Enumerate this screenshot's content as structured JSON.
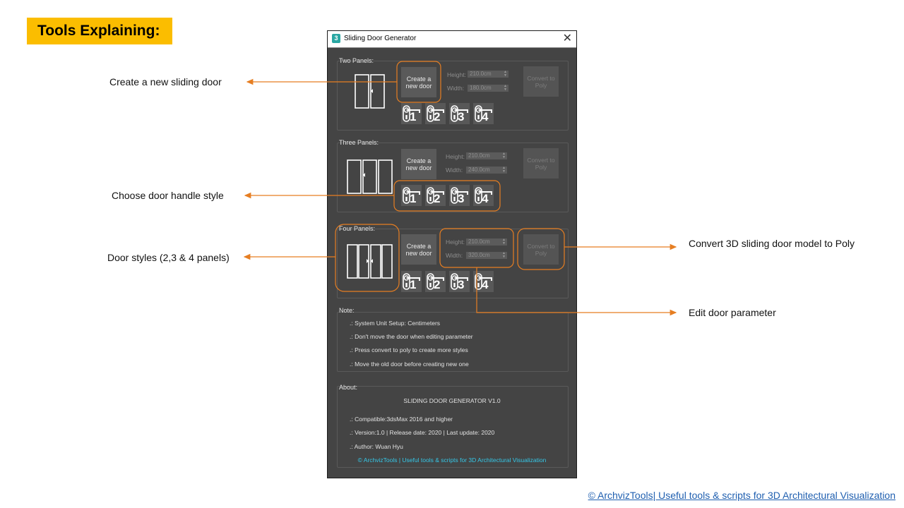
{
  "page": {
    "heading": "Tools Explaining:",
    "footer_link": "© ArchvizTools| Useful tools & scripts for 3D Architectural Visualization"
  },
  "annotations": {
    "create": "Create a new sliding door",
    "handle": "Choose door handle style",
    "styles": "Door styles (2,3 & 4 panels)",
    "convert": "Convert 3D sliding door model to Poly",
    "edit": "Edit door parameter"
  },
  "window": {
    "title": "Sliding Door Generator",
    "icon_text": "3",
    "close_glyph": "✕",
    "labels": {
      "create": "Create a new door",
      "convert": "Convert to Poly",
      "height": "Height:",
      "width": "Width:"
    },
    "groups": [
      {
        "label": "Two Panels:",
        "height": "210.0cm",
        "width": "180.0cm",
        "panels": 2
      },
      {
        "label": "Three Panels:",
        "height": "210.0cm",
        "width": "240.0cm",
        "panels": 3
      },
      {
        "label": "Four Panels:",
        "height": "210.0cm",
        "width": "320.0cm",
        "panels": 4
      }
    ],
    "handles": [
      "1",
      "2",
      "3",
      "4"
    ],
    "note": {
      "label": "Note:",
      "lines": [
        ".: System Unit Setup: Centimeters",
        ".: Don't move the door when editing parameter",
        ".: Press convert to poly to create more styles",
        ".: Move the old door before creating new one"
      ]
    },
    "about": {
      "label": "About:",
      "title": "SLIDING DOOR GENERATOR V1.0",
      "lines": [
        ".: Compatible:3dsMax 2016 and higher",
        ".: Version:1.0 | Release date: 2020 | Last update: 2020",
        ".: Author: Wuan Hyu"
      ],
      "credit": "© ArchvizTools | Useful tools & scripts for 3D Architectural Visualization"
    }
  },
  "colors": {
    "accent": "#e67e22",
    "badge": "#fbbd00",
    "panel_bg": "#444444",
    "link": "#1f5fb0",
    "credit": "#35c8e8"
  }
}
